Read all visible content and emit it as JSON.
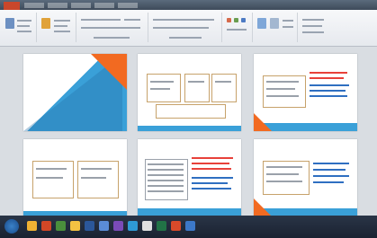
{
  "window": {
    "file_tab": ""
  },
  "slides": [
    {
      "title": "",
      "subtitle": ""
    },
    {
      "title": "",
      "subtitle": ""
    },
    {
      "title": "",
      "subtitle": ""
    },
    {
      "title": "",
      "subtitle": ""
    },
    {
      "title": "",
      "subtitle": ""
    },
    {
      "title": "",
      "subtitle": ""
    }
  ],
  "taskbar": {
    "clock": ""
  },
  "colors": {
    "accent_blue": "#3aa0d8",
    "accent_orange": "#f26a21",
    "title_blue": "#3a77b5",
    "file_tab": "#c9472b"
  },
  "icons": [
    "windows-start-icon",
    "explorer-icon",
    "powerpoint-icon",
    "chrome-icon",
    "word-icon",
    "excel-icon"
  ]
}
